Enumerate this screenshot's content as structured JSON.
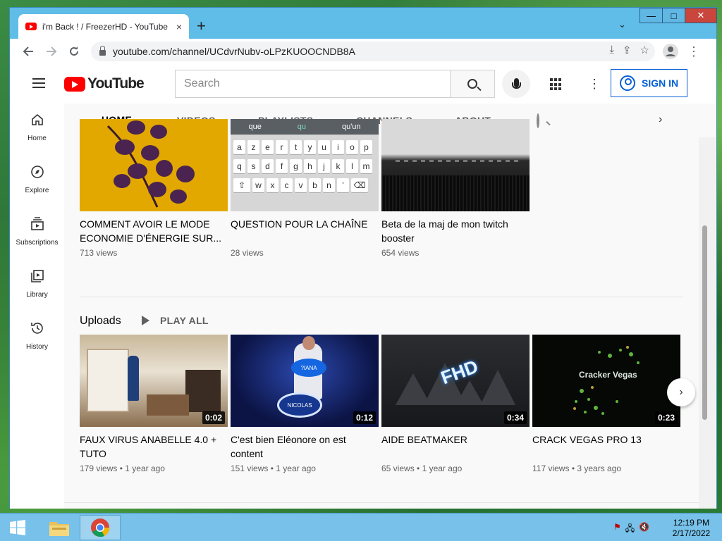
{
  "browser": {
    "tab_title": "i'm Back ! / FreezerHD - YouTube",
    "tab_close": "×",
    "new_tab": "+",
    "tab_list": "⌄",
    "url": "youtube.com/channel/UCdvrNubv-oLPzKUOOCNDB8A",
    "window_controls": {
      "minimize": "—",
      "maximize": "□",
      "close": "✕"
    }
  },
  "yt_header": {
    "logo_text": "YouTube",
    "search_placeholder": "Search",
    "sign_in": "SIGN IN",
    "more": "⋮"
  },
  "guide": [
    {
      "label": "Home",
      "icon": "home-icon",
      "glyph": "⌂"
    },
    {
      "label": "Explore",
      "icon": "compass-icon",
      "glyph": "◉"
    },
    {
      "label": "Subscriptions",
      "icon": "subscriptions-icon",
      "glyph": "▣"
    },
    {
      "label": "Library",
      "icon": "library-icon",
      "glyph": "▶"
    },
    {
      "label": "History",
      "icon": "history-icon",
      "glyph": "◷"
    }
  ],
  "channel_tabs": [
    "HOME",
    "VIDEOS",
    "PLAYLISTS",
    "CHANNELS",
    "ABOUT"
  ],
  "top_videos": [
    {
      "title": "COMMENT AVOIR LE MODE ECONOMIE D'ÉNERGIE SUR...",
      "meta": "713 views"
    },
    {
      "title": "QUESTION POUR LA CHAÎNE",
      "meta": "28 views"
    },
    {
      "title": "Beta de la maj de mon twitch booster",
      "meta": "654 views"
    }
  ],
  "keyboard": {
    "suggestions": [
      "que",
      "qu",
      "qu'un"
    ],
    "row1": [
      "a",
      "z",
      "e",
      "r",
      "t",
      "y",
      "u",
      "i",
      "o",
      "p"
    ],
    "row2": [
      "q",
      "s",
      "d",
      "f",
      "g",
      "h",
      "j",
      "k",
      "l",
      "m"
    ],
    "row3": [
      "w",
      "x",
      "c",
      "v",
      "b",
      "n",
      "'"
    ]
  },
  "uploads": {
    "title": "Uploads",
    "play_all": "PLAY ALL",
    "videos": [
      {
        "title": "FAUX VIRUS ANABELLE 4.0 + TUTO",
        "views": "179 views",
        "age": "1 year ago",
        "duration": "0:02"
      },
      {
        "title": "C'est bien Eléonore on est content",
        "views": "151 views",
        "age": "1 year ago",
        "duration": "0:12",
        "overlay1": "?IANA",
        "overlay2": "NICOLAS"
      },
      {
        "title": "AIDE BEATMAKER",
        "views": "65 views",
        "age": "1 year ago",
        "duration": "0:34",
        "overlay1": "FHD"
      },
      {
        "title": "CRACK VEGAS PRO 13",
        "views": "117 views",
        "age": "3 years ago",
        "duration": "0:23",
        "overlay1": "Cracker Vegas"
      }
    ],
    "separator": "•"
  },
  "taskbar": {
    "time": "12:19 PM",
    "date": "2/17/2022"
  }
}
